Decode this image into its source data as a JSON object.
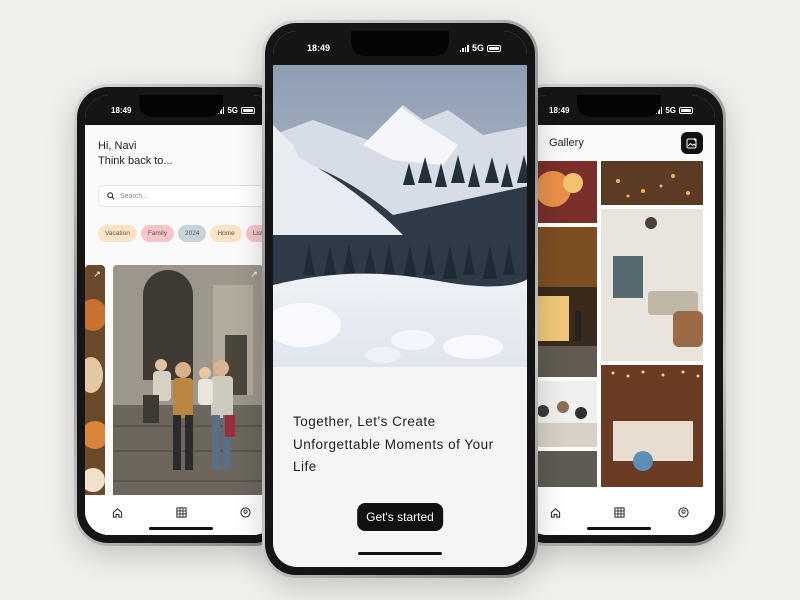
{
  "left_phone": {
    "status": {
      "time": "18:49",
      "network": "5G"
    },
    "greeting": {
      "line1": "Hi, Navi",
      "line2": "Think back to..."
    },
    "search": {
      "placeholder": "Search..."
    },
    "chips": [
      {
        "label": "Vacation",
        "color": "#fbe3c4"
      },
      {
        "label": "Family",
        "color": "#f7c5c8"
      },
      {
        "label": "2024",
        "color": "#c6d3dd"
      },
      {
        "label": "Home",
        "color": "#fbe3c4"
      },
      {
        "label": "Listy",
        "color": "#f7c5c8"
      }
    ],
    "nav": [
      "home-icon",
      "grid-icon",
      "profile-icon"
    ]
  },
  "center_phone": {
    "status": {
      "time": "18:49",
      "network": "5G"
    },
    "welcome_text": "Together, Let's Create Unforgettable Moments of Your Life",
    "cta_label": "Get's started"
  },
  "right_phone": {
    "status": {
      "time": "18:49",
      "network": "5G"
    },
    "title": "Gallery",
    "nav": [
      "home-icon",
      "grid-icon",
      "profile-icon"
    ]
  },
  "colors": {
    "background": "#f1efeb",
    "accent": "#111111"
  }
}
